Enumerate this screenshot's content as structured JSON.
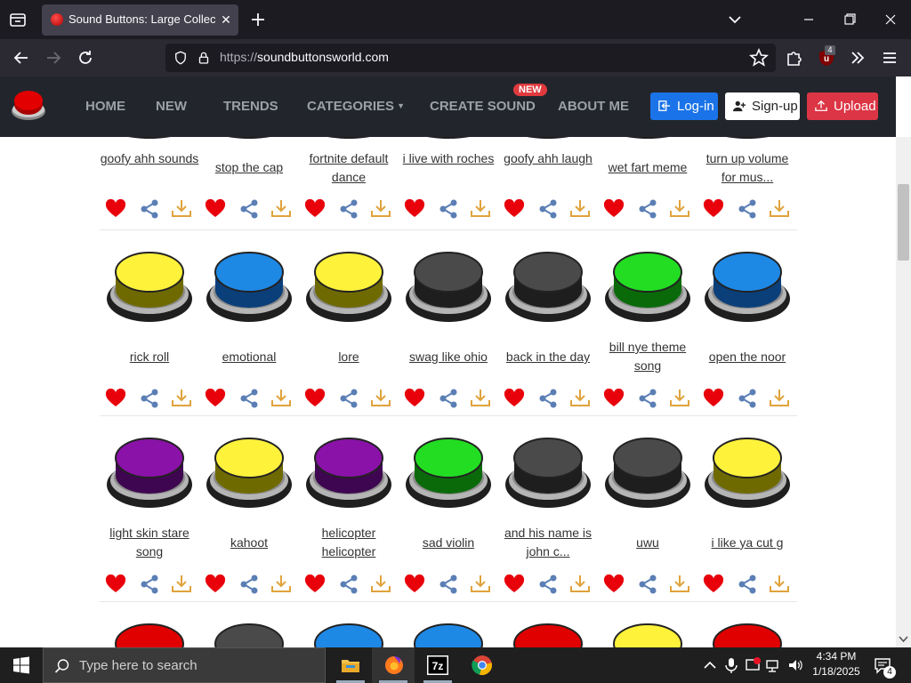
{
  "browser": {
    "tab_title": "Sound Buttons: Large Collection",
    "url_protocol": "https://",
    "url_host": "soundbuttonsworld.com",
    "extension_badge": "4"
  },
  "site": {
    "nav": [
      "HOME",
      "NEW",
      "TRENDS",
      "CATEGORIES",
      "CREATE SOUND",
      "ABOUT ME"
    ],
    "new_badge": "NEW",
    "login": "Log-in",
    "signup": "Sign-up",
    "upload": "Upload",
    "colors": {
      "header_bg": "#22262c",
      "heart": "#e8000b",
      "share": "#5b7fb5",
      "download": "#e0a33c",
      "login": "#1a73e8",
      "upload": "#dc3545"
    }
  },
  "rows": [
    {
      "partial_top": true,
      "labels": [
        "goofy ahh sounds",
        "stop the cap",
        "fortnite default dance",
        "i live with roches",
        "goofy ahh laugh",
        "wet fart meme",
        "turn up volume for mus..."
      ]
    },
    {
      "colors": [
        "yellow",
        "blue",
        "yellow",
        "gray",
        "gray",
        "green",
        "blue"
      ],
      "labels": [
        "rick roll",
        "emotional",
        "lore",
        "swag like ohio",
        "back in the day",
        "bill nye theme song",
        "open the noor"
      ]
    },
    {
      "colors": [
        "purple",
        "yellow",
        "purple",
        "green",
        "gray",
        "gray",
        "yellow"
      ],
      "labels": [
        "light skin stare song",
        "kahoot",
        "helicopter helicopter",
        "sad violin",
        "and his name is john c...",
        "uwu",
        "i like ya cut g"
      ]
    },
    {
      "partial_bottom": true,
      "colors": [
        "red",
        "gray",
        "blue",
        "blue",
        "red",
        "yellow",
        "red"
      ]
    }
  ],
  "button_palette": {
    "yellow": [
      "#fff23b",
      "#6f6a00"
    ],
    "blue": [
      "#1e88e5",
      "#0b3f7a"
    ],
    "gray": [
      "#4a4a4a",
      "#1e1e1e"
    ],
    "green": [
      "#22dd22",
      "#0a6a0a"
    ],
    "purple": [
      "#8a12a8",
      "#3e0650"
    ],
    "red": [
      "#e00000",
      "#6a0000"
    ]
  },
  "taskbar": {
    "search_placeholder": "Type here to search",
    "time": "4:34 PM",
    "date": "1/18/2025",
    "notifications": "4"
  }
}
